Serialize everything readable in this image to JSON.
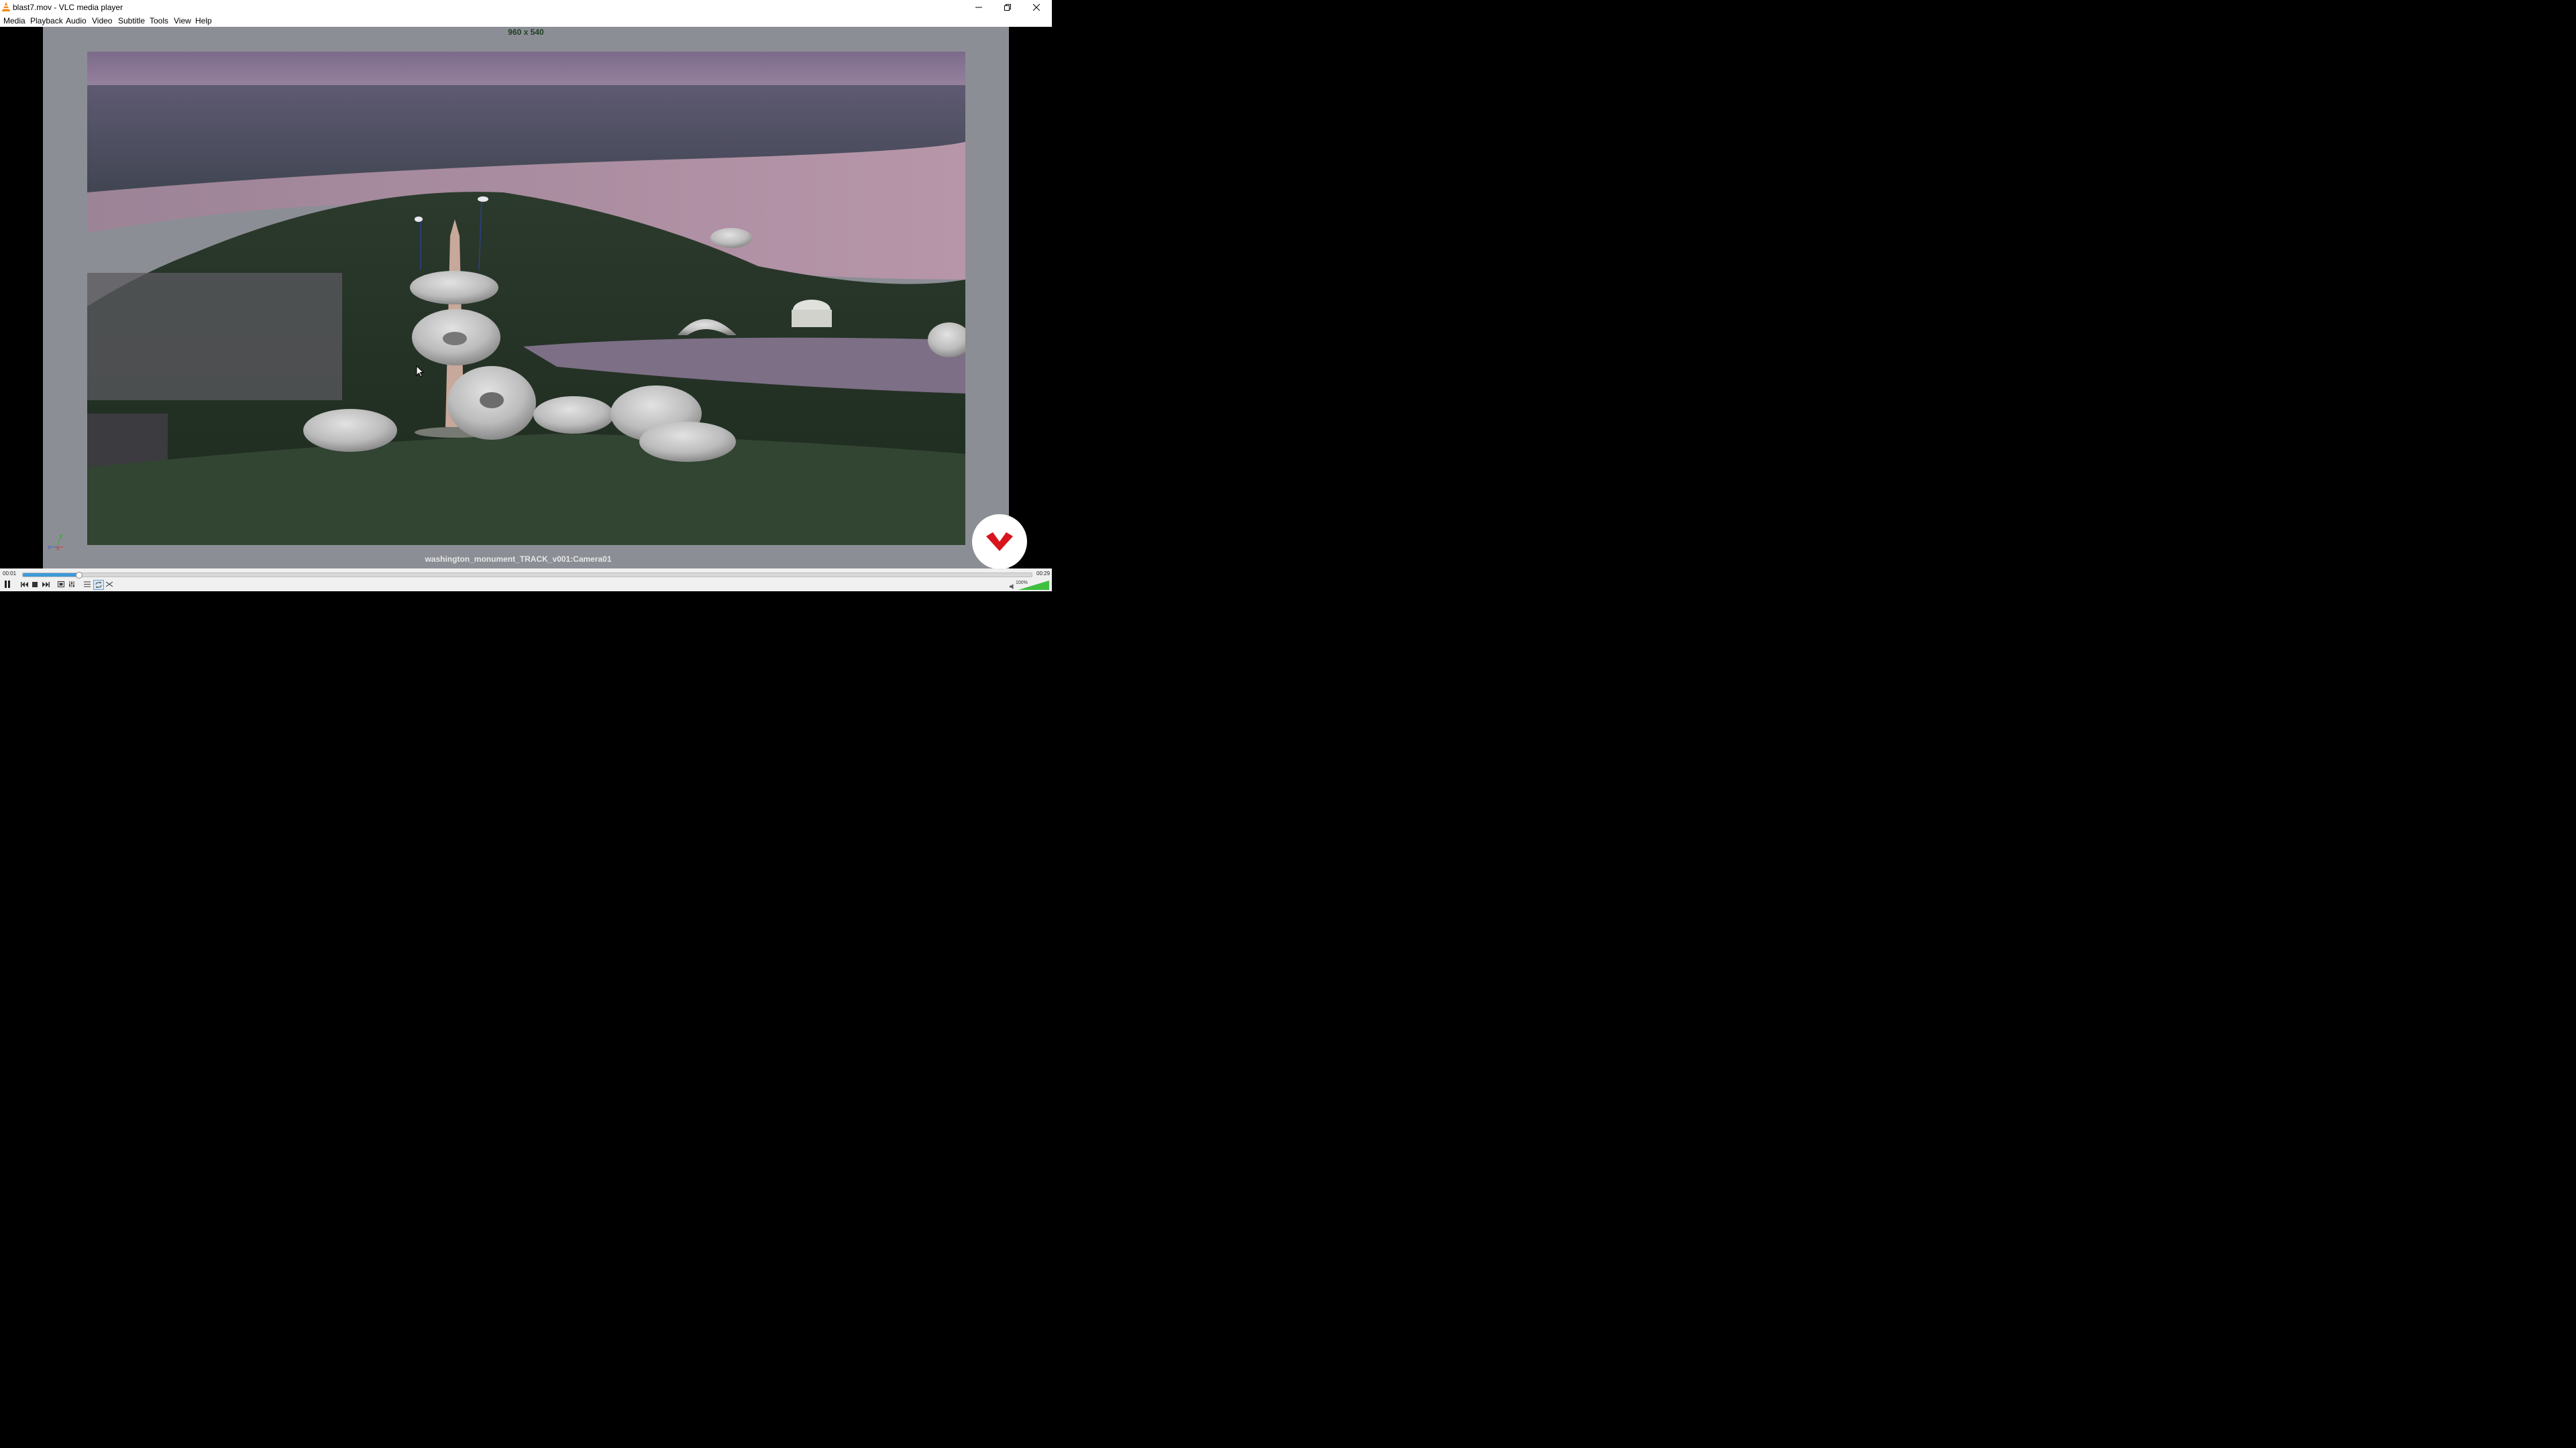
{
  "window": {
    "title": "blast7.mov - VLC media player",
    "minimize_label": "─",
    "restore_label": "❐",
    "close_label": "✕"
  },
  "menu": {
    "items": [
      "Media",
      "Playback",
      "Audio",
      "Video",
      "Subtitle",
      "Tools",
      "View",
      "Help"
    ]
  },
  "video": {
    "resolution_label": "960 x 540",
    "camera_label": "washington_monument_TRACK_v001:Camera01",
    "axis_labels": {
      "y": "y",
      "z": "z",
      "x": "x"
    }
  },
  "playback": {
    "current_time": "00:01",
    "total_time": "00:29",
    "progress_fraction": 0.055,
    "volume_label": "100%",
    "volume_fraction": 1.0,
    "accent_color": "#3d9ad8"
  },
  "icons": {
    "app": "vlc-cone-icon",
    "play_pause": "pause-icon",
    "prev": "previous-icon",
    "stop": "stop-icon",
    "next": "next-icon",
    "fullscreen": "fullscreen-icon",
    "extended": "equalizer-icon",
    "playlist": "playlist-icon",
    "loop": "loop-icon",
    "shuffle": "shuffle-icon",
    "speaker": "speaker-icon",
    "logo": "red-chevron-logo"
  }
}
